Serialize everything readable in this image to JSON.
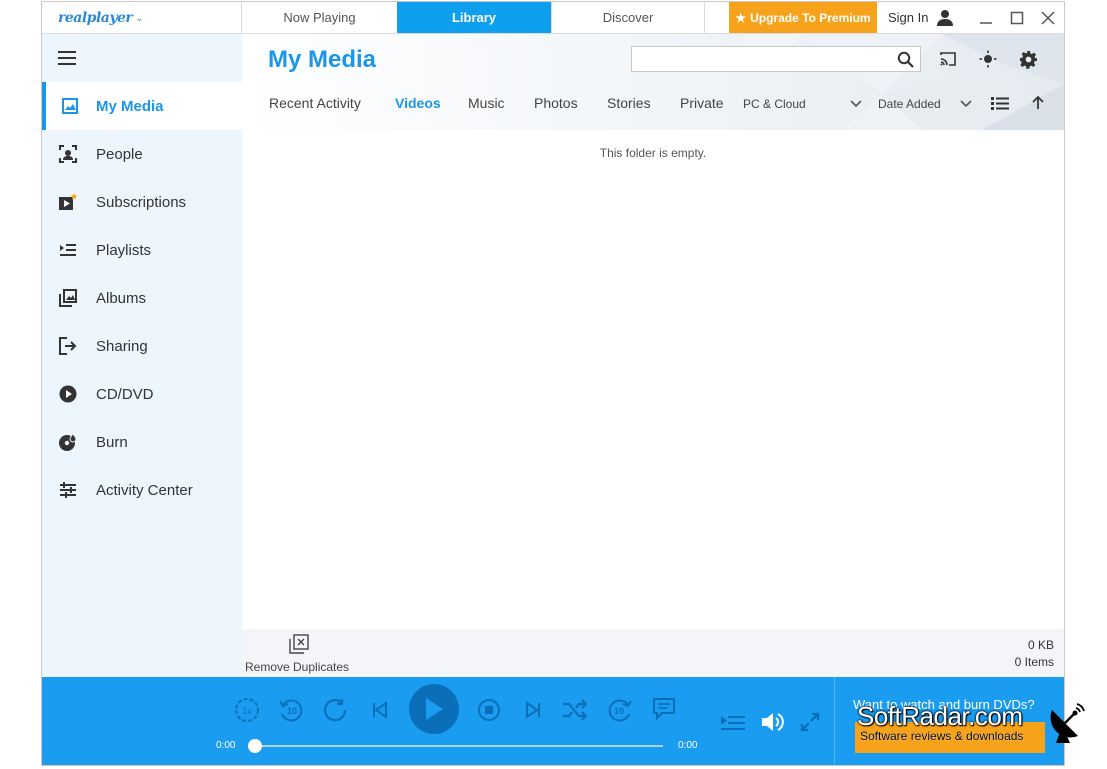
{
  "titlebar": {
    "logo": "realplayer",
    "tabs": [
      {
        "label": "Now Playing",
        "active": false
      },
      {
        "label": "Library",
        "active": true
      },
      {
        "label": "Discover",
        "active": false
      }
    ],
    "premium_label": "Upgrade To Premium",
    "sign_in_label": "Sign In"
  },
  "sidebar": {
    "items": [
      {
        "label": "My Media",
        "icon": "image-icon",
        "active": true
      },
      {
        "label": "People",
        "icon": "face-scan-icon",
        "active": false
      },
      {
        "label": "Subscriptions",
        "icon": "subscriptions-icon",
        "active": false
      },
      {
        "label": "Playlists",
        "icon": "playlist-icon",
        "active": false
      },
      {
        "label": "Albums",
        "icon": "albums-icon",
        "active": false
      },
      {
        "label": "Sharing",
        "icon": "share-icon",
        "active": false
      },
      {
        "label": "CD/DVD",
        "icon": "disc-play-icon",
        "active": false
      },
      {
        "label": "Burn",
        "icon": "burn-icon",
        "active": false
      },
      {
        "label": "Activity Center",
        "icon": "sliders-icon",
        "active": false
      }
    ]
  },
  "header": {
    "title": "My Media",
    "search_placeholder": "",
    "subtabs": [
      {
        "label": "Recent Activity",
        "active": false
      },
      {
        "label": "Videos",
        "active": true
      },
      {
        "label": "Music",
        "active": false
      },
      {
        "label": "Photos",
        "active": false
      },
      {
        "label": "Stories",
        "active": false
      },
      {
        "label": "Private",
        "active": false
      }
    ],
    "source_filter": "PC & Cloud",
    "sort_label": "Date Added"
  },
  "content": {
    "empty_message": "This folder is empty."
  },
  "status": {
    "remove_duplicates_label": "Remove Duplicates",
    "total_size": "0 KB",
    "item_count": "0 Items"
  },
  "player": {
    "current_time": "0:00",
    "total_time": "0:00",
    "progress": 0,
    "promo_text": "Want to watch and burn DVDs?"
  },
  "watermark": {
    "title": "SoftRadar.com",
    "subtitle": "Software reviews & downloads"
  },
  "colors": {
    "accent": "#1c96e8",
    "tab_active": "#0ea0ef",
    "premium": "#f7a21b",
    "player_bg": "#1a9cf0",
    "sidebar_bg": "#edf6fd"
  }
}
